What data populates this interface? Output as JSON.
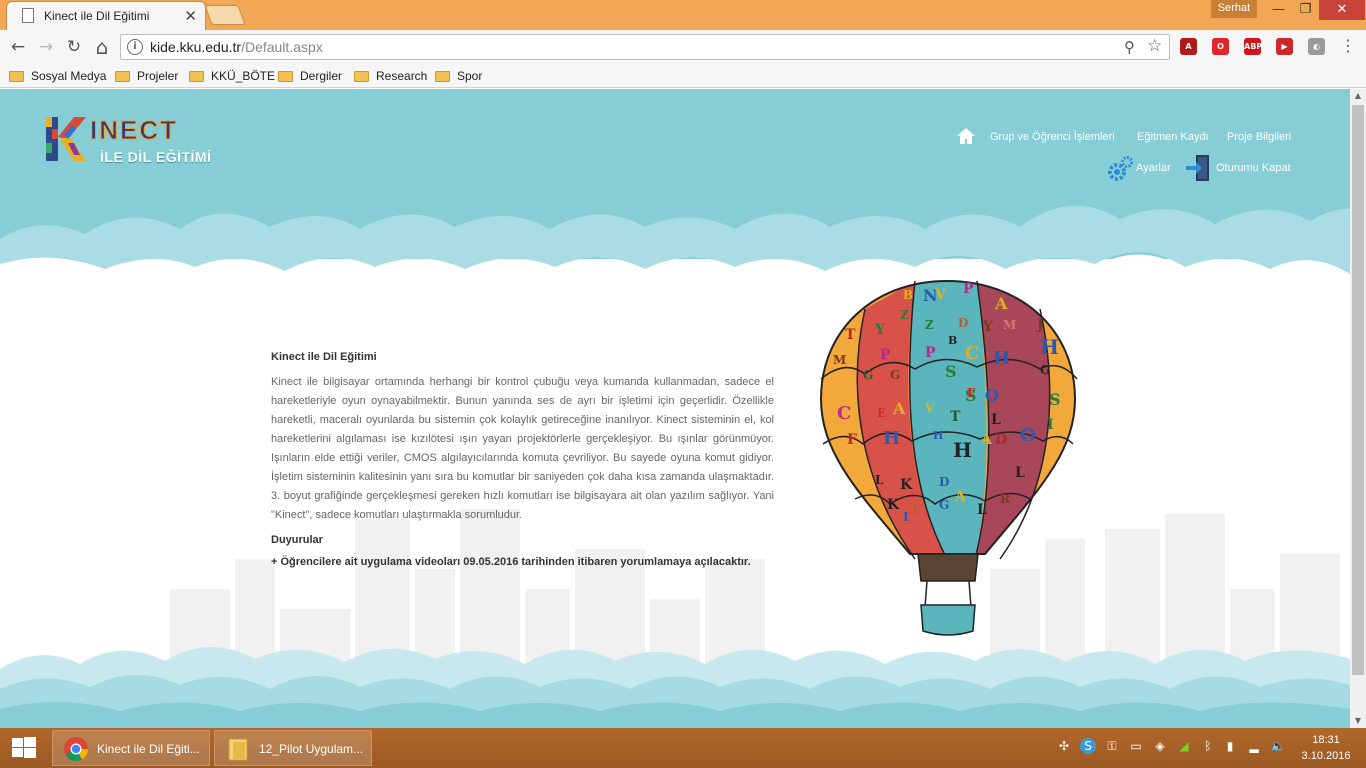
{
  "browser": {
    "tab_title": "Kinect ile Dil Eğitimi",
    "tab_close": "✕",
    "profile_name": "Serhat",
    "window": {
      "minimize": "—",
      "maximize": "❐",
      "close": "✕"
    },
    "nav": {
      "back": "←",
      "forward": "→",
      "reload": "↻",
      "home": "⌂"
    },
    "url_host": "kide.kku.edu.tr",
    "url_path": "/Default.aspx",
    "zoom_icon": "⚲",
    "star_icon": "☆",
    "extensions": [
      {
        "name": "pdf-extension-icon",
        "color": "#b11a1a",
        "label": "A"
      },
      {
        "name": "opera-extension-icon",
        "color": "#e0262a",
        "label": "O"
      },
      {
        "name": "adblock-plus-icon",
        "color": "#d0161c",
        "label": "ABP"
      },
      {
        "name": "video-extension-icon",
        "color": "#cc2a2a",
        "label": "▶"
      },
      {
        "name": "user-extension-icon",
        "color": "#9a9a9a",
        "label": "◐"
      }
    ],
    "menu": "⋮",
    "bookmarks": [
      "Sosyal Medya",
      "Projeler",
      "KKÜ_BÖTE",
      "Dergiler",
      "Research",
      "Spor"
    ]
  },
  "site": {
    "logo_text": "INECT",
    "logo_k": "K",
    "logo_sub": "İLE DİL EĞİTİMİ",
    "nav": {
      "groups": "Grup ve Öğrenci İşlemleri",
      "trainer": "Eğitmen Kaydı",
      "project": "Proje Bilgileri",
      "settings": "Ayarlar",
      "logout": "Oturumu Kapat"
    },
    "content": {
      "title": "Kinect ile Dil Eğitimi",
      "body": "Kinect ile bilgisayar ortamında herhangi bir kontrol çubuğu veya kumanda kullanmadan, sadece el hareketleriyle oyun oynayabilmektir. Bunun yanında ses de ayrı bir işletimi için geçerlidir. Özellikle hareketli, maceralı oyunlarda bu sistemin çok kolaylık getireceğine inanılıyor. Kinect sisteminin el, kol hareketlerini algılaması ise kızılötesi ışın yayan projektörlerle gerçekleşiyor. Bu ışınlar görünmüyor. Işınların elde ettiği veriler, CMOS algılayıcılarında komuta çevriliyor. Bu sayede oyuna komut gidiyor. İşletim sisteminin kalitesinin yanı sıra bu komutlar bir saniyeden çok daha kısa zamanda ulaşmaktadır. 3. boyut grafiğinde gerçekleşmesi gereken hızlı komutları ise bilgisayara ait olan yazılım sağlıyor. Yani \"Kinect\", sadece komutları ulaştırmakla sorumludur.",
      "announcements_title": "Duyurular",
      "announcement": "+ Öğrencilere ait uygulama videoları 09.05.2016 tarihinden itibaren yorumlamaya açılacaktır."
    }
  },
  "taskbar": {
    "tasks": [
      "Kinect ile Dil Eğiti...",
      "12_Pilot Uygulam..."
    ],
    "time": "18:31",
    "date": "3.10.2016"
  },
  "colors": {
    "header_teal": "#86cdd6",
    "cloud_light": "#a9dce4",
    "titlebar": "#f1a753",
    "taskbar": "#a5602a"
  }
}
